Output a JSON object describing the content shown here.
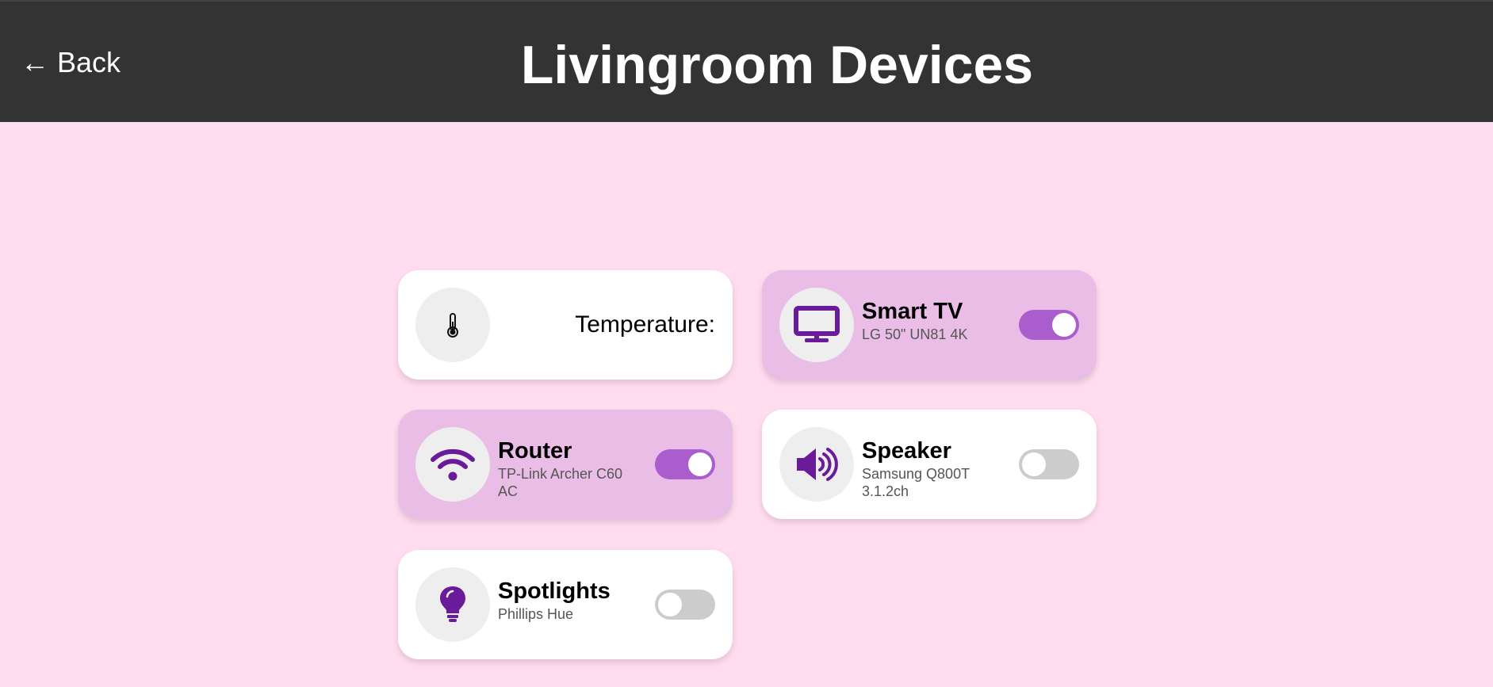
{
  "header": {
    "back_label": "← Back",
    "title": "Livingroom Devices"
  },
  "colors": {
    "background": "#ffdcee",
    "header": "#333333",
    "card_on": "#e9bde6",
    "card_off": "#ffffff",
    "toggle_on": "#aa5dcc",
    "toggle_off": "#cccccc",
    "icon_purple": "#6a1b9a"
  },
  "devices": {
    "temperature": {
      "label": "Temperature:",
      "icon": "thermometer-icon"
    },
    "smart_tv": {
      "name": "Smart TV",
      "model": "LG 50\" UN81 4K",
      "on": true,
      "icon": "monitor-icon"
    },
    "router": {
      "name": "Router",
      "model": "TP-Link Archer C60 AC",
      "on": true,
      "icon": "wifi-icon"
    },
    "speaker": {
      "name": "Speaker",
      "model": "Samsung Q800T 3.1.2ch",
      "on": false,
      "icon": "speaker-icon"
    },
    "spotlights": {
      "name": "Spotlights",
      "model": "Phillips Hue",
      "on": false,
      "icon": "lightbulb-icon"
    }
  }
}
